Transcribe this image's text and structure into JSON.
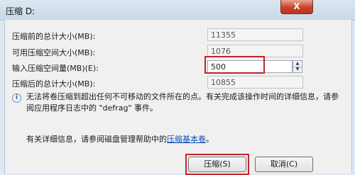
{
  "window": {
    "title": "压缩 D:",
    "close_label": "X"
  },
  "rows": [
    {
      "label": "压缩前的总计大小(MB):",
      "value": "11355"
    },
    {
      "label": "可用压缩空间大小(MB):",
      "value": "1076"
    },
    {
      "label": "输入压缩空间量(MB)(E):",
      "value": "500"
    },
    {
      "label": "压缩后的总计大小(MB):",
      "value": "10855"
    }
  ],
  "info": {
    "text": "无法将卷压缩到超出任何不可移动的文件所在的点。有关完成该操作时间的详细信息，请参阅应用程序日志中的 \"defrag\" 事件。"
  },
  "help": {
    "text": "有关详细信息，请参阅磁盘管理帮助中的",
    "link": "压缩基本卷",
    "suffix": "。"
  },
  "buttons": {
    "shrink_label": "压缩(S)",
    "cancel_label": "取消(C)"
  }
}
